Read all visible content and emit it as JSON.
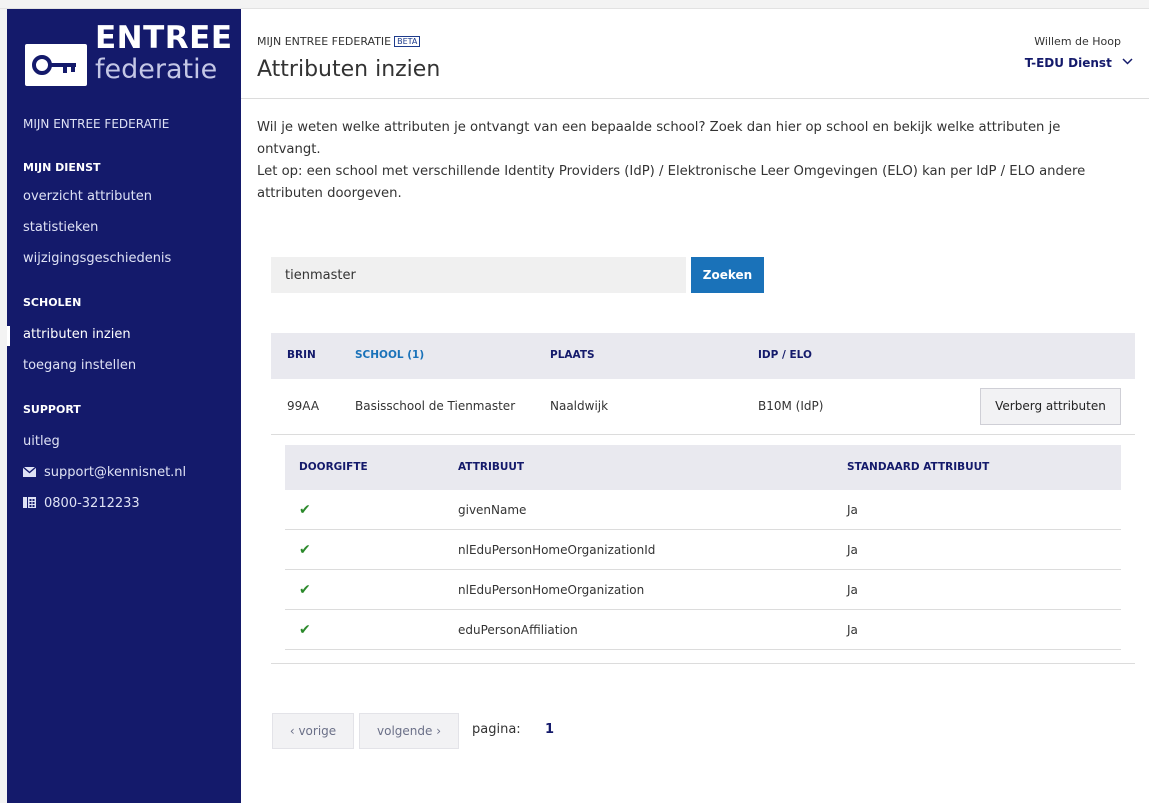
{
  "brand": {
    "line1": "ENTREE",
    "line2": "federatie"
  },
  "sidebar": {
    "top_label": "MIJN ENTREE FEDERATIE",
    "sections": [
      {
        "title": "MIJN DIENST",
        "items": [
          "overzicht attributen",
          "statistieken",
          "wijzigingsgeschiedenis"
        ]
      },
      {
        "title": "SCHOLEN",
        "items": [
          "attributen inzien",
          "toegang instellen"
        ]
      },
      {
        "title": "SUPPORT",
        "items": [
          "uitleg",
          "support@kennisnet.nl",
          "0800-3212233"
        ]
      }
    ],
    "active_item": "attributen inzien"
  },
  "header": {
    "breadcrumb": "MIJN ENTREE FEDERATIE",
    "badge": "BETA",
    "title": "Attributen inzien",
    "user_name": "Willem de Hoop",
    "org": "T-EDU Dienst"
  },
  "intro": {
    "p1": "Wil je weten welke attributen je ontvangt van een bepaalde school? Zoek dan hier op school en bekijk welke attributen je ontvangt.",
    "p2": "Let op: een school met verschillende Identity Providers (IdP) / Elektronische Leer Omgevingen (ELO) kan per IdP / ELO andere attributen doorgeven."
  },
  "search": {
    "value": "tienmaster",
    "button": "Zoeken"
  },
  "results": {
    "columns": [
      "BRIN",
      "SCHOOL (1)",
      "PLAATS",
      "IDP / ELO"
    ],
    "row": {
      "brin": "99AA",
      "school": "Basisschool de Tienmaster",
      "plaats": "Naaldwijk",
      "idp": "B10M (IdP)",
      "button": "Verberg attributen"
    }
  },
  "attributes": {
    "columns": [
      "DOORGIFTE",
      "ATTRIBUUT",
      "STANDAARD ATTRIBUUT"
    ],
    "rows": [
      {
        "doorgifte": "✔",
        "name": "givenName",
        "standaard": "Ja"
      },
      {
        "doorgifte": "✔",
        "name": "nlEduPersonHomeOrganizationId",
        "standaard": "Ja"
      },
      {
        "doorgifte": "✔",
        "name": "nlEduPersonHomeOrganization",
        "standaard": "Ja"
      },
      {
        "doorgifte": "✔",
        "name": "eduPersonAffiliation",
        "standaard": "Ja"
      }
    ]
  },
  "pagination": {
    "prev": "‹ vorige",
    "next": "volgende ›",
    "label": "pagina:",
    "page": "1"
  },
  "colors": {
    "sidebar": "#141a6b",
    "accent": "#1a72b9",
    "check": "#2c8a2c"
  }
}
